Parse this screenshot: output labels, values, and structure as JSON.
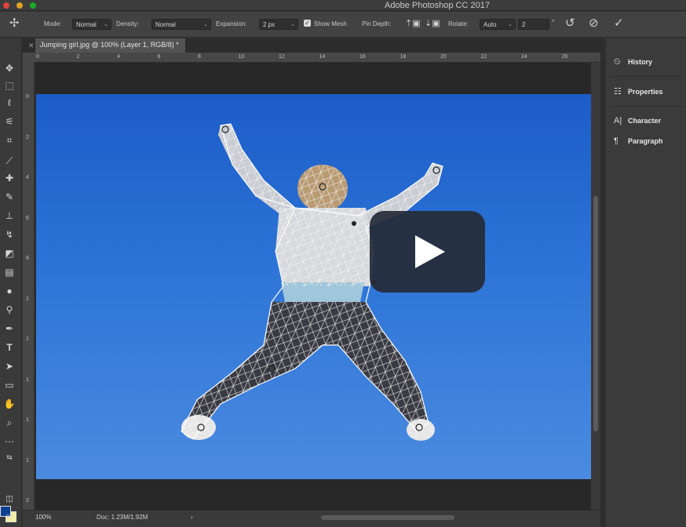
{
  "window": {
    "title": "Adobe Photoshop CC 2017"
  },
  "options_bar": {
    "mode_label": "Mode:",
    "mode_value": "Normal",
    "density_label": "Density:",
    "density_value": "Normal",
    "expansion_label": "Expansion:",
    "expansion_value": "2 px",
    "show_mesh_label": "Show Mesh",
    "show_mesh_checked": true,
    "pin_depth_label": "Pin Depth:",
    "rotate_label": "Rotate:",
    "rotate_value": "Auto",
    "rotate_degrees": "2",
    "degree_symbol": "°"
  },
  "document": {
    "tab_title": "Jumping girl.jpg @ 100% (Layer 1, RGB/8) *"
  },
  "rulers": {
    "h_ticks": [
      "0",
      "2",
      "4",
      "6",
      "8",
      "10",
      "12",
      "14",
      "16",
      "18",
      "20",
      "22",
      "24",
      "26"
    ],
    "v_ticks": [
      "0",
      "2",
      "4",
      "6",
      "8",
      "1",
      "1",
      "1",
      "1",
      "1",
      "2"
    ]
  },
  "panels": [
    {
      "label": "History",
      "icon": "history-icon"
    },
    {
      "label": "Properties",
      "icon": "properties-icon"
    },
    {
      "label": "Character",
      "icon": "character-icon"
    },
    {
      "label": "Paragraph",
      "icon": "paragraph-icon"
    }
  ],
  "status": {
    "zoom": "100%",
    "doc_info": "Doc: 1.23M/1.92M",
    "arrow": "›"
  },
  "colors": {
    "foreground": "#0f3f91",
    "background": "#f3eda2",
    "sky_top": "#1c5cc7",
    "sky_bottom": "#4b8be0"
  },
  "tools": [
    "move-icon",
    "marquee-icon",
    "lasso-icon",
    "magic-wand-icon",
    "crop-icon",
    "eyedropper-icon",
    "healing-icon",
    "brush-icon",
    "stamp-icon",
    "history-brush-icon",
    "eraser-icon",
    "gradient-icon",
    "blur-icon",
    "dodge-icon",
    "pen-icon",
    "type-icon",
    "path-select-icon",
    "rectangle-icon",
    "hand-icon",
    "zoom-icon",
    "more-tools-icon"
  ]
}
